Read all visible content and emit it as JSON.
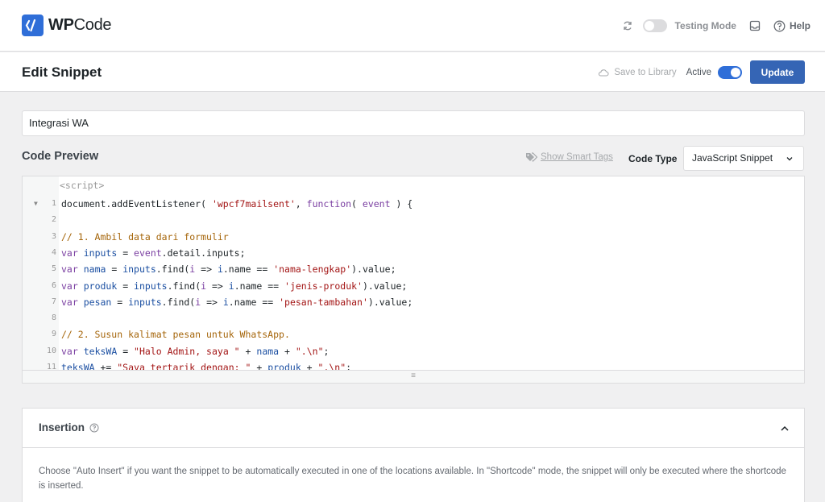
{
  "header": {
    "logo_text_bold": "WP",
    "logo_text_rest": "Code",
    "testing_mode_label": "Testing Mode",
    "help_label": "Help"
  },
  "edit_bar": {
    "title": "Edit Snippet",
    "save_to_library": "Save to Library",
    "active_label": "Active",
    "update_button": "Update"
  },
  "snippet": {
    "title_value": "Integrasi WA"
  },
  "code_preview": {
    "section_title": "Code Preview",
    "smart_tags_link": "Show Smart Tags",
    "code_type_label": "Code Type",
    "code_type_value": "JavaScript Snippet",
    "script_open_tag": "<script>",
    "lines": [
      {
        "n": "1",
        "fold": true,
        "tokens": [
          [
            "plain",
            "document.addEventListener( "
          ],
          [
            "str",
            "'wpcf7mailsent'"
          ],
          [
            "plain",
            ", "
          ],
          [
            "kw",
            "function"
          ],
          [
            "plain",
            "( "
          ],
          [
            "kw",
            "event"
          ],
          [
            "plain",
            " ) {"
          ]
        ]
      },
      {
        "n": "2",
        "tokens": []
      },
      {
        "n": "3",
        "tokens": [
          [
            "cm",
            "// 1. Ambil data dari formulir"
          ]
        ]
      },
      {
        "n": "4",
        "tokens": [
          [
            "kw",
            "var"
          ],
          [
            "plain",
            " "
          ],
          [
            "var",
            "inputs"
          ],
          [
            "plain",
            " = "
          ],
          [
            "kw",
            "event"
          ],
          [
            "plain",
            ".detail.inputs;"
          ]
        ]
      },
      {
        "n": "5",
        "tokens": [
          [
            "kw",
            "var"
          ],
          [
            "plain",
            " "
          ],
          [
            "var",
            "nama"
          ],
          [
            "plain",
            " = "
          ],
          [
            "var",
            "inputs"
          ],
          [
            "plain",
            ".find("
          ],
          [
            "kw",
            "i"
          ],
          [
            "plain",
            " => "
          ],
          [
            "var",
            "i"
          ],
          [
            "plain",
            ".name == "
          ],
          [
            "str",
            "'nama-lengkap'"
          ],
          [
            "plain",
            ").value;"
          ]
        ]
      },
      {
        "n": "6",
        "tokens": [
          [
            "kw",
            "var"
          ],
          [
            "plain",
            " "
          ],
          [
            "var",
            "produk"
          ],
          [
            "plain",
            " = "
          ],
          [
            "var",
            "inputs"
          ],
          [
            "plain",
            ".find("
          ],
          [
            "kw",
            "i"
          ],
          [
            "plain",
            " => "
          ],
          [
            "var",
            "i"
          ],
          [
            "plain",
            ".name == "
          ],
          [
            "str",
            "'jenis-produk'"
          ],
          [
            "plain",
            ").value;"
          ]
        ]
      },
      {
        "n": "7",
        "tokens": [
          [
            "kw",
            "var"
          ],
          [
            "plain",
            " "
          ],
          [
            "var",
            "pesan"
          ],
          [
            "plain",
            " = "
          ],
          [
            "var",
            "inputs"
          ],
          [
            "plain",
            ".find("
          ],
          [
            "kw",
            "i"
          ],
          [
            "plain",
            " => "
          ],
          [
            "var",
            "i"
          ],
          [
            "plain",
            ".name == "
          ],
          [
            "str",
            "'pesan-tambahan'"
          ],
          [
            "plain",
            ").value;"
          ]
        ]
      },
      {
        "n": "8",
        "tokens": []
      },
      {
        "n": "9",
        "tokens": [
          [
            "cm",
            "// 2. Susun kalimat pesan untuk WhatsApp."
          ]
        ]
      },
      {
        "n": "10",
        "tokens": [
          [
            "kw",
            "var"
          ],
          [
            "plain",
            " "
          ],
          [
            "var",
            "teksWA"
          ],
          [
            "plain",
            " = "
          ],
          [
            "str",
            "\"Halo Admin, saya \""
          ],
          [
            "plain",
            " + "
          ],
          [
            "var",
            "nama"
          ],
          [
            "plain",
            " + "
          ],
          [
            "str",
            "\".\\n\""
          ],
          [
            "plain",
            ";"
          ]
        ]
      },
      {
        "n": "11",
        "tokens": [
          [
            "var",
            "teksWA"
          ],
          [
            "plain",
            " += "
          ],
          [
            "str",
            "\"Saya tertarik dengan: \""
          ],
          [
            "plain",
            " + "
          ],
          [
            "var",
            "produk"
          ],
          [
            "plain",
            " + "
          ],
          [
            "str",
            "\".\\n\""
          ],
          [
            "plain",
            ";"
          ]
        ]
      }
    ],
    "resize_handle": "≡"
  },
  "insertion": {
    "title": "Insertion",
    "description": "Choose \"Auto Insert\" if you want the snippet to be automatically executed in one of the locations available. In \"Shortcode\" mode, the snippet will only be executed where the shortcode is inserted."
  },
  "colors": {
    "brand": "#2f6ed8",
    "update_button": "#3565b5",
    "keyword": "#7a3ea1",
    "variable": "#1a4ea1",
    "string": "#a31515",
    "comment": "#a5650a"
  }
}
